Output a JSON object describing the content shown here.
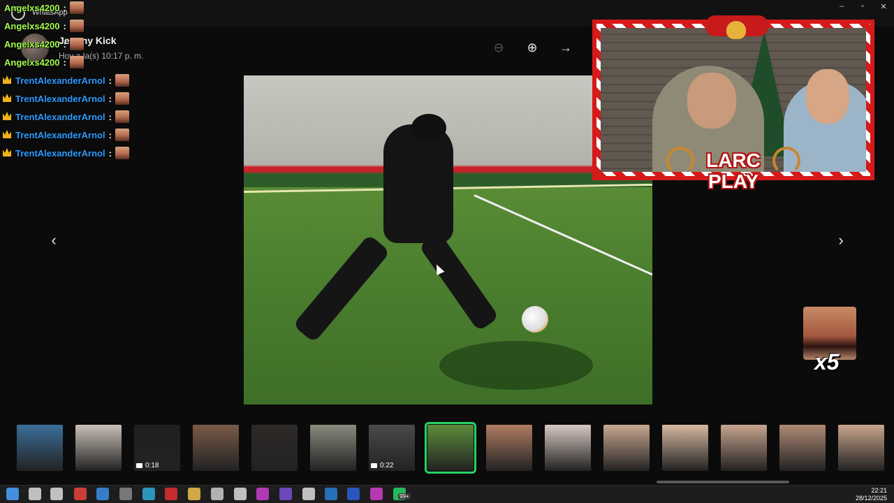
{
  "window": {
    "title": "WhatsApp",
    "minimize": "–",
    "maximize": "▫",
    "close": "✕"
  },
  "viewer": {
    "contact_name": "Jeremy Kick",
    "timestamp": "Hoy a la(s) 10:17 p. m.",
    "zoom_out": "⊖",
    "zoom_in": "⊕",
    "forward": "→",
    "prev": "‹",
    "next": "›"
  },
  "chat": {
    "green_users": [
      "Angelxs4200",
      "Angelxs4200",
      "Angelxs4200",
      "Angelxs4200"
    ],
    "blue_users": [
      "TrentAlexanderArnol",
      "TrentAlexanderArnol",
      "TrentAlexanderArnol",
      "TrentAlexanderArnol",
      "TrentAlexanderArnol"
    ],
    "separator": ":"
  },
  "overlay": {
    "logo_line1": "LARC",
    "logo_line2": "PLAY",
    "combo_count": "x5"
  },
  "thumbnails": [
    {
      "duration": ""
    },
    {
      "duration": ""
    },
    {
      "duration": "0:18"
    },
    {
      "duration": ""
    },
    {
      "duration": ""
    },
    {
      "duration": ""
    },
    {
      "duration": "0:22"
    },
    {
      "duration": "",
      "selected": true
    },
    {
      "duration": ""
    },
    {
      "duration": ""
    },
    {
      "duration": ""
    },
    {
      "duration": ""
    },
    {
      "duration": ""
    },
    {
      "duration": ""
    },
    {
      "duration": ""
    }
  ],
  "taskbar": {
    "badge": "99+",
    "time": "22:21",
    "date": "28/12/2025"
  },
  "colors": {
    "accent": "#25d366",
    "chat_green": "#a6ff4d",
    "chat_blue": "#2e9bff",
    "frame_red": "#d61a1a"
  }
}
